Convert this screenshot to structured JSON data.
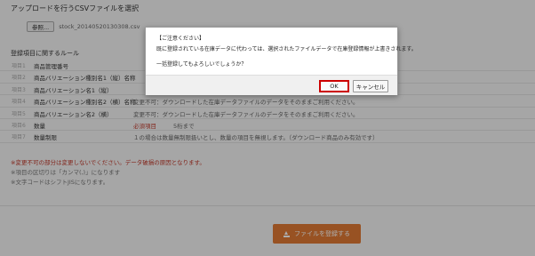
{
  "upload": {
    "title": "アップロードを行うCSVファイルを選択",
    "browse_label": "参照...",
    "file_name": "stock_20140520130308.csv"
  },
  "rules": {
    "title": "登録項目に関するルール",
    "rows": [
      {
        "tag": "項目1",
        "name": "商品管理番号",
        "desc": ""
      },
      {
        "tag": "項目2",
        "name": "商品バリエーション種別名1（縦）名称",
        "desc": ""
      },
      {
        "tag": "項目3",
        "name": "商品バリエーション名1（縦）",
        "desc": ""
      },
      {
        "tag": "項目4",
        "name": "商品バリエーション種別名2（横）名称",
        "desc": "変更不可：ダウンロードした在庫データファイルのデータをそのままご利用ください。"
      },
      {
        "tag": "項目5",
        "name": "商品バリエーション名2（横）",
        "desc": "変更不可：ダウンロードした在庫データファイルのデータをそのままご利用ください。"
      },
      {
        "tag": "項目6",
        "name": "数量",
        "desc": "必須項目",
        "desc2": "5桁まで"
      },
      {
        "tag": "項目7",
        "name": "数量制限",
        "desc": "１の場合は数量無制限扱いとし、数量の項目を無視します。（ダウンロード商品のみ有効です）"
      }
    ]
  },
  "notes": [
    {
      "text": "※変更不可の部分は変更しないでください。データ破損の原因となります。",
      "red": true
    },
    {
      "text": "※項目の区切りは「カンマ(,)」になります",
      "red": false
    },
    {
      "text": "※文字コードはシフトJISになります。",
      "red": false
    }
  ],
  "register_button": {
    "label": "ファイルを登録する",
    "icon": "upload-icon"
  },
  "dialog": {
    "heading": "【ご注意ください】",
    "body": "既に登録されている在庫データに代わっては、選択されたファイルデータで在庫登録情報が上書きされます。",
    "question": "一括登録してもよろしいでしょうか？",
    "ok_label": "OK",
    "cancel_label": "キャンセル"
  },
  "colors": {
    "accent": "#e07a34",
    "highlight": "#cc0000",
    "warning_text": "#c0392b"
  }
}
